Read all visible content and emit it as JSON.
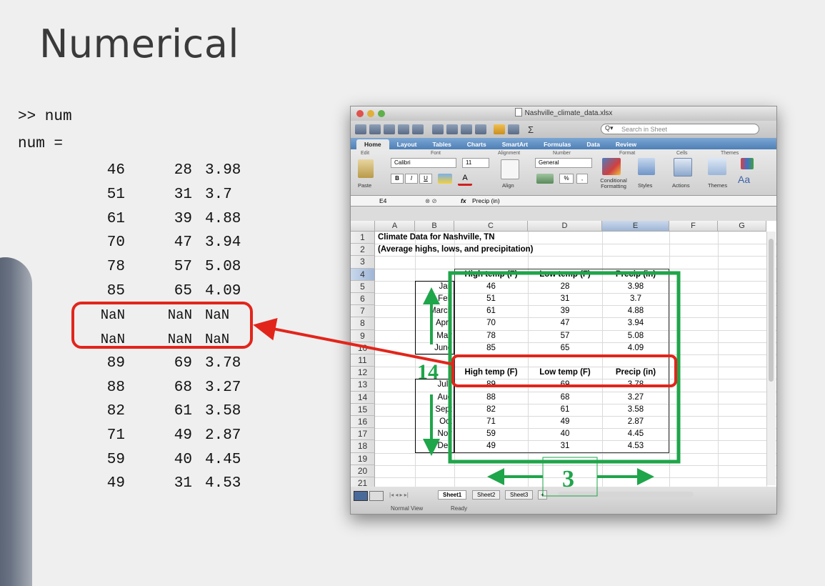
{
  "slide": {
    "title": "Numerical"
  },
  "console": {
    "prompt_line": ">> num",
    "output_header": "num =",
    "rows": [
      [
        "46",
        "28",
        "3.98"
      ],
      [
        "51",
        "31",
        "3.7"
      ],
      [
        "61",
        "39",
        "4.88"
      ],
      [
        "70",
        "47",
        "3.94"
      ],
      [
        "78",
        "57",
        "5.08"
      ],
      [
        "85",
        "65",
        "4.09"
      ],
      [
        "NaN",
        "NaN",
        "NaN"
      ],
      [
        "NaN",
        "NaN",
        "NaN"
      ],
      [
        "89",
        "69",
        "3.78"
      ],
      [
        "88",
        "68",
        "3.27"
      ],
      [
        "82",
        "61",
        "3.58"
      ],
      [
        "71",
        "49",
        "2.87"
      ],
      [
        "59",
        "40",
        "4.45"
      ],
      [
        "49",
        "31",
        "4.53"
      ]
    ]
  },
  "excel": {
    "window_title": "Nashville_climate_data.xlsx",
    "search_placeholder": "Search in Sheet",
    "ribbon_tabs": [
      "Home",
      "Layout",
      "Tables",
      "Charts",
      "SmartArt",
      "Formulas",
      "Data",
      "Review"
    ],
    "groups": {
      "edit": "Edit",
      "font": "Font",
      "alignment": "Alignment",
      "number": "Number",
      "format": "Format",
      "cells": "Cells",
      "themes": "Themes"
    },
    "font_name": "Calibri",
    "font_size": "11",
    "number_format": "General",
    "buttons": {
      "paste": "Paste",
      "align": "Align",
      "conditional": "Conditional Formatting",
      "styles": "Styles",
      "actions": "Actions",
      "themes": "Themes",
      "bold": "B",
      "italic": "I",
      "underline": "U",
      "percent": "%",
      "comma": ","
    },
    "name_box": "E4",
    "fx": "fx",
    "formula": "Precip (in)",
    "columns": [
      "A",
      "B",
      "C",
      "D",
      "E",
      "F",
      "G"
    ],
    "row_numbers": [
      "1",
      "2",
      "3",
      "4",
      "5",
      "6",
      "7",
      "8",
      "9",
      "10",
      "11",
      "12",
      "13",
      "14",
      "15",
      "16",
      "17",
      "18",
      "19",
      "20",
      "21"
    ],
    "title1": "Climate Data for Nashville, TN",
    "title2": "(Average highs, lows, and precipitation)",
    "headers_row4": [
      "High temp (F)",
      "Low temp (F)",
      "Precip (in)"
    ],
    "headers_row12": [
      "High temp (F)",
      "Low temp (F)",
      "Precip (in)"
    ],
    "months": [
      "Jan",
      "Feb",
      "March",
      "April",
      "May",
      "June",
      "July",
      "Aug",
      "Sept",
      "Oct",
      "Nov",
      "Dec"
    ],
    "data_top": [
      [
        "46",
        "28",
        "3.98"
      ],
      [
        "51",
        "31",
        "3.7"
      ],
      [
        "61",
        "39",
        "4.88"
      ],
      [
        "70",
        "47",
        "3.94"
      ],
      [
        "78",
        "57",
        "5.08"
      ],
      [
        "85",
        "65",
        "4.09"
      ]
    ],
    "data_row13": [
      "89",
      "69",
      "3.78"
    ],
    "data_bottom": [
      [
        "88",
        "68",
        "3.27"
      ],
      [
        "82",
        "61",
        "3.58"
      ],
      [
        "71",
        "49",
        "2.87"
      ],
      [
        "59",
        "40",
        "4.45"
      ],
      [
        "49",
        "31",
        "4.53"
      ]
    ],
    "sheets": [
      "Sheet1",
      "Sheet2",
      "Sheet3"
    ],
    "view_label": "Normal View",
    "status": "Ready"
  },
  "annotations": {
    "rows_label": "14",
    "cols_label": "3"
  },
  "colors": {
    "red": "#e2251b",
    "green": "#1fa54a"
  }
}
